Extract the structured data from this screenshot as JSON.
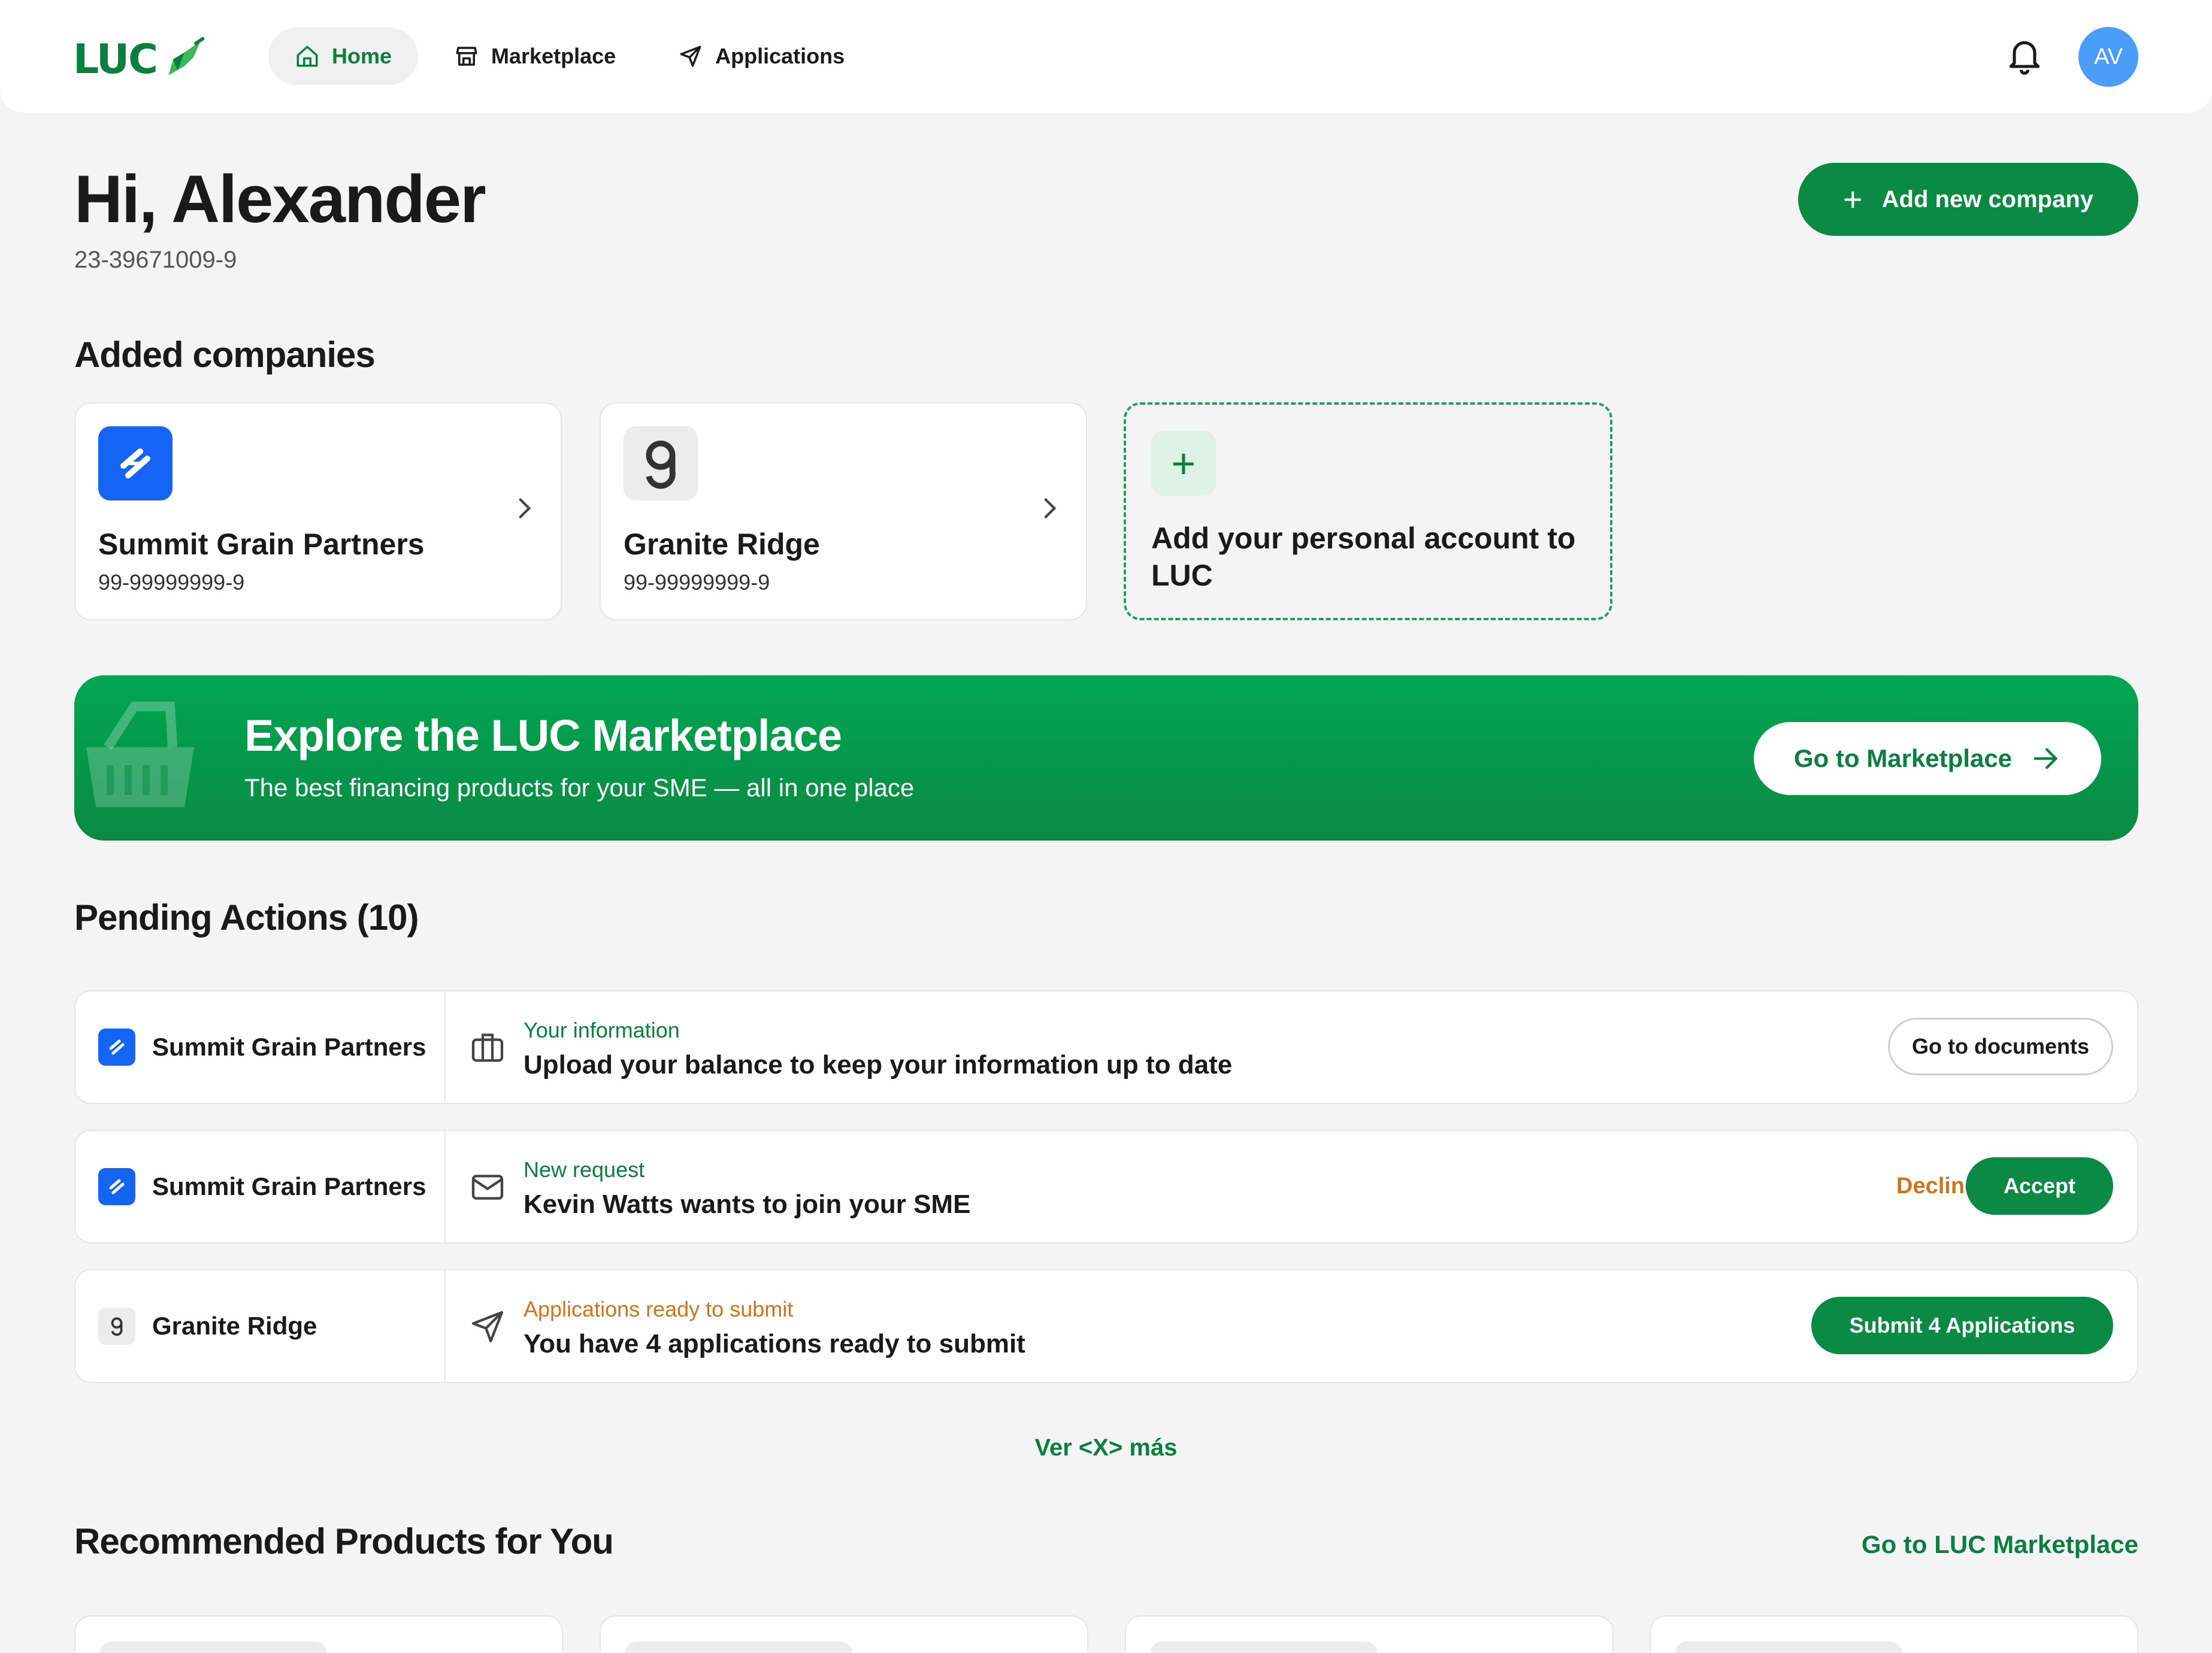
{
  "header": {
    "logo_text": "LUC",
    "nav": [
      {
        "label": "Home",
        "icon": "home-icon",
        "active": true
      },
      {
        "label": "Marketplace",
        "icon": "store-icon",
        "active": false
      },
      {
        "label": "Applications",
        "icon": "send-icon",
        "active": false
      }
    ],
    "avatar_initials": "AV"
  },
  "greeting": {
    "title": "Hi, Alexander",
    "tax_id": "23-39671009-9",
    "add_company_label": "Add new company"
  },
  "companies": {
    "title": "Added companies",
    "items": [
      {
        "name": "Summit Grain Partners",
        "id": "99-99999999-9",
        "logo": "summit-logo-icon"
      },
      {
        "name": "Granite Ridge",
        "id": "99-99999999-9",
        "logo": "granite-logo-icon"
      }
    ],
    "add_personal": "Add your personal account to LUC"
  },
  "banner": {
    "title": "Explore the LUC Marketplace",
    "subtitle": "The best financing products for your SME — all in one place",
    "button": "Go to Marketplace"
  },
  "pending": {
    "title": "Pending Actions (10)",
    "rows": [
      {
        "company": "Summit Grain Partners",
        "icon": "briefcase-icon",
        "kind": "Your information",
        "message": "Upload your balance to keep your information up to date",
        "action": "Go to documents"
      },
      {
        "company": "Summit Grain Partners",
        "icon": "mail-icon",
        "kind": "New request",
        "message": "Kevin Watts wants to join your SME",
        "decline": "Decline",
        "accept": "Accept"
      },
      {
        "company": "Granite Ridge",
        "icon": "send-icon",
        "kind": "Applications ready to submit",
        "message": "You have 4 applications ready to submit",
        "action": "Submit 4 Applications"
      }
    ],
    "see_more": "Ver <X> más"
  },
  "recommended": {
    "title": "Recommended Products for You",
    "link": "Go to LUC Marketplace"
  },
  "colors": {
    "brand_green": "#0a8a43",
    "accent_orange": "#d2731b",
    "summit_blue": "#1565f5",
    "avatar_blue": "#4a9df8"
  }
}
